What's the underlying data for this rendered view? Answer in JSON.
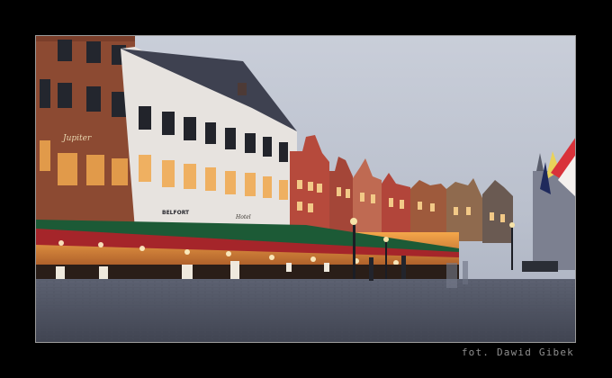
{
  "photo": {
    "signs": {
      "belfort": "BELFORT",
      "jupiter": "Jupiter",
      "hotel": "Hotel"
    }
  },
  "credit": "fot. Dawid Gibek"
}
